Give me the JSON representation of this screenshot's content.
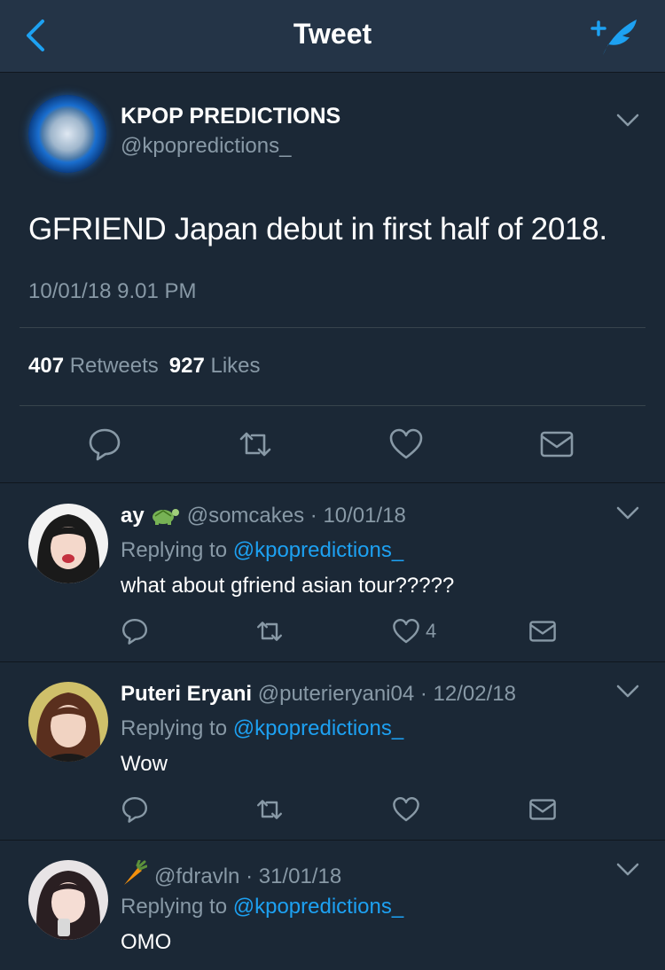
{
  "nav": {
    "title": "Tweet",
    "back_icon": "chevron-left-icon",
    "compose_icon": "compose-tweet-icon",
    "accent": "#1da1f2"
  },
  "tweet": {
    "name": "KPOP PREDICTIONS",
    "handle": "@kpopredictions_",
    "text": "GFRIEND Japan debut in first half of 2018.",
    "timestamp": "10/01/18 9.01 PM",
    "retweets": {
      "count": "407",
      "label": "Retweets"
    },
    "likes": {
      "count": "927",
      "label": "Likes"
    },
    "actions": [
      "reply-icon",
      "retweet-icon",
      "like-icon",
      "message-icon"
    ]
  },
  "replies": [
    {
      "name": "ay",
      "emoji": "turtle",
      "handle": "@somcakes",
      "date": "· 10/01/18",
      "replying_label": "Replying to",
      "mention": "@kpopredictions_",
      "text": "what about gfriend asian tour?????",
      "like_count": "4"
    },
    {
      "name": "Puteri Eryani",
      "emoji": "",
      "handle": "@puterieryani04",
      "date": "· 12/02/18",
      "replying_label": "Replying to",
      "mention": "@kpopredictions_",
      "text": "Wow",
      "like_count": ""
    },
    {
      "name": "",
      "emoji": "carrot",
      "handle": "@fdravln",
      "date": "· 31/01/18",
      "replying_label": "Replying to",
      "mention": "@kpopredictions_",
      "text": "OMO",
      "like_count": ""
    }
  ],
  "colors": {
    "background": "#1b2836",
    "navbar": "#243447",
    "muted_text": "#8899a6",
    "link": "#1da1f2"
  }
}
